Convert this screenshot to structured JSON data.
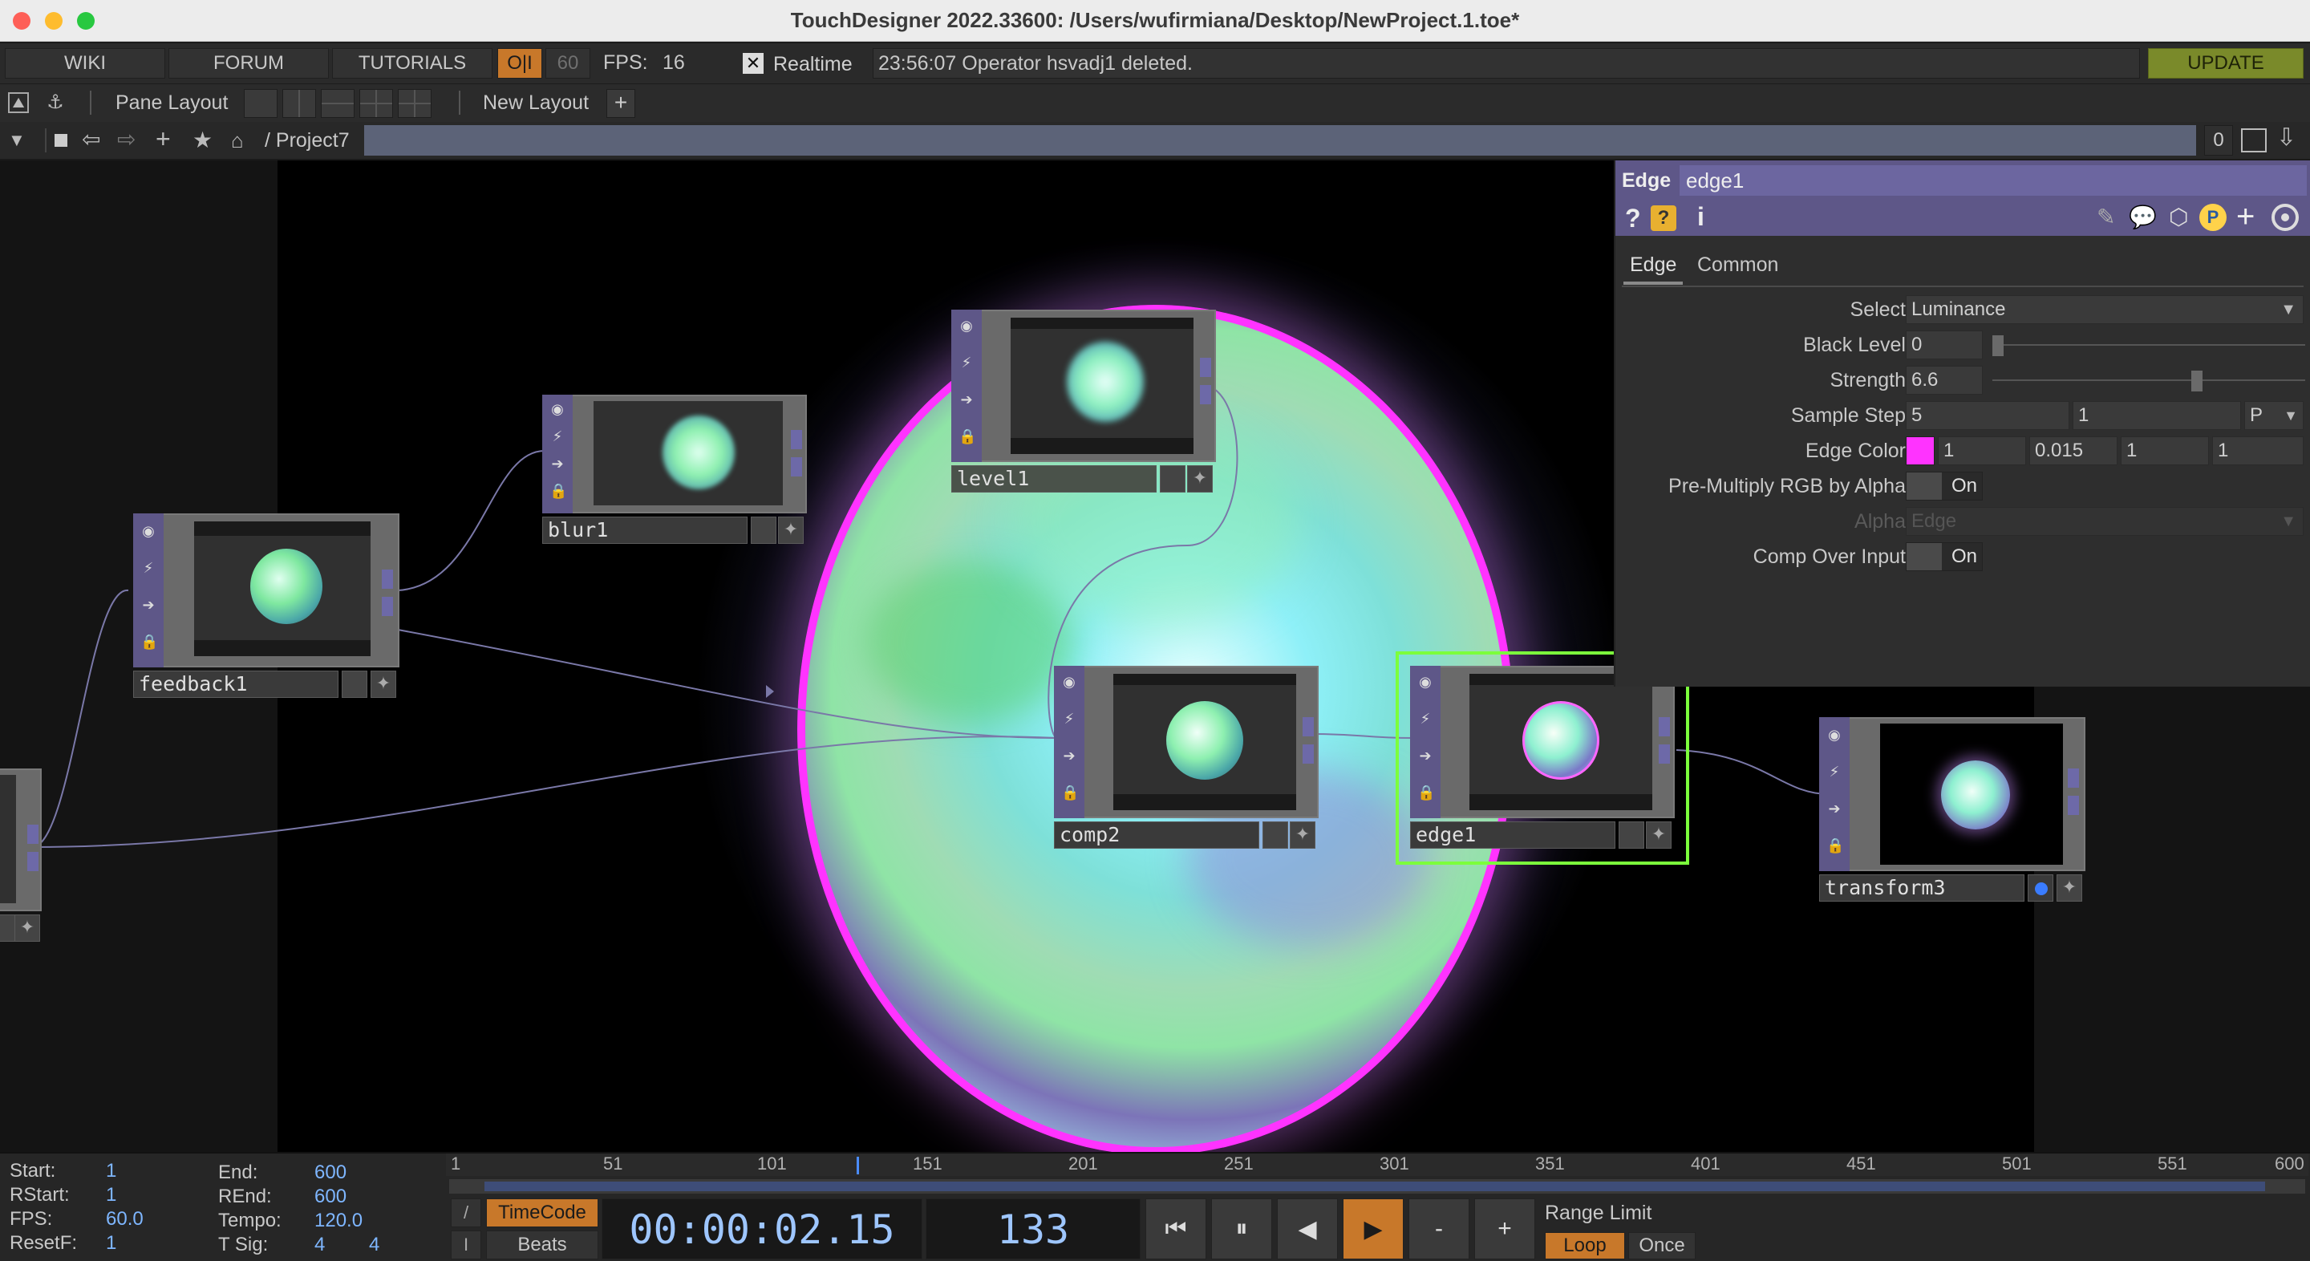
{
  "window": {
    "title": "TouchDesigner 2022.33600: /Users/wufirmiana/Desktop/NewProject.1.toe*"
  },
  "menubar": {
    "wiki": "WIKI",
    "forum": "FORUM",
    "tutorials": "TUTORIALS",
    "oi": "O|I",
    "fps_target": "60",
    "fps_label": "FPS:",
    "fps_value": "16",
    "realtime_label": "Realtime",
    "status_message": "23:56:07 Operator hsvadj1 deleted.",
    "update": "UPDATE"
  },
  "panebar": {
    "pane_layout": "Pane Layout",
    "new_layout": "New Layout",
    "plus": "+"
  },
  "pathbar": {
    "path": "/ Project7",
    "counter": "0"
  },
  "nodes": {
    "feedback1": "feedback1",
    "blur1": "blur1",
    "level1": "level1",
    "comp2": "comp2",
    "edge1": "edge1",
    "transform3": "transform3"
  },
  "params": {
    "op_type": "Edge",
    "op_name": "edge1",
    "tabs": [
      "Edge",
      "Common"
    ],
    "rows": {
      "select_label": "Select",
      "select_value": "Luminance",
      "black_level_label": "Black Level",
      "black_level_value": "0",
      "strength_label": "Strength",
      "strength_value": "6.6",
      "sample_step_label": "Sample Step",
      "sample_step_1": "5",
      "sample_step_2": "1",
      "sample_step_mode": "P",
      "edge_color_label": "Edge Color",
      "edge_color_r": "1",
      "edge_color_g": "0.015",
      "edge_color_b": "1",
      "edge_color_a": "1",
      "premultiply_label": "Pre-Multiply RGB by Alpha",
      "premultiply_value": "On",
      "alpha_label": "Alpha",
      "alpha_value": "Edge",
      "comp_over_label": "Comp Over Input",
      "comp_over_value": "On"
    },
    "edge_color_swatch": "#ff33ff"
  },
  "timeline": {
    "start_label": "Start:",
    "start_value": "1",
    "rstart_label": "RStart:",
    "rstart_value": "1",
    "fps_label": "FPS:",
    "fps_value": "60.0",
    "resetf_label": "ResetF:",
    "resetf_value": "1",
    "end_label": "End:",
    "end_value": "600",
    "rend_label": "REnd:",
    "rend_value": "600",
    "tempo_label": "Tempo:",
    "tempo_value": "120.0",
    "tsig_label": "T Sig:",
    "tsig_a": "4",
    "tsig_b": "4",
    "ticks": [
      "1",
      "51",
      "101",
      "151",
      "201",
      "251",
      "301",
      "351",
      "401",
      "451",
      "501",
      "551",
      "600"
    ],
    "timecode_label": "TimeCode",
    "beats_label": "Beats",
    "timecode_value": "00:00:02.15",
    "frame_value": "133",
    "range_limit": "Range Limit",
    "loop": "Loop",
    "once": "Once",
    "minus": "-",
    "plus": "+"
  },
  "colors": {
    "accent_orange": "#c8782a",
    "update_green": "#7a8a2a",
    "node_purple": "#5e5788",
    "selected_green": "#7cff3c",
    "edge_magenta": "#ff33ff"
  }
}
